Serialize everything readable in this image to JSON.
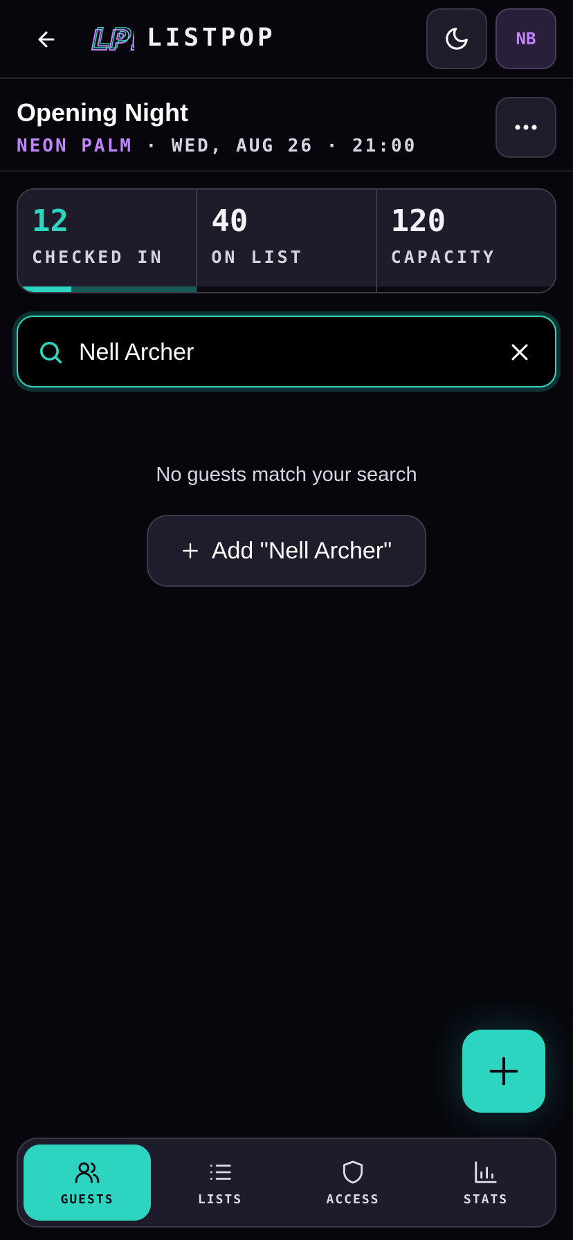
{
  "app": {
    "brand": "LISTPOP",
    "logo_text": "LP!",
    "user_initials": "NB"
  },
  "event": {
    "title": "Opening Night",
    "venue": "NEON PALM",
    "details": "· WED, AUG 26 · 21:00"
  },
  "stats": [
    {
      "value": "12",
      "label": "CHECKED IN",
      "progress": 0.3
    },
    {
      "value": "40",
      "label": "ON LIST"
    },
    {
      "value": "120",
      "label": "CAPACITY"
    }
  ],
  "search": {
    "value": "Nell Archer"
  },
  "empty_state": {
    "message": "No guests match your search",
    "add_label": "Add \"Nell Archer\""
  },
  "nav": [
    {
      "label": "GUESTS",
      "icon": "users-icon",
      "active": true
    },
    {
      "label": "LISTS",
      "icon": "list-icon",
      "active": false
    },
    {
      "label": "ACCESS",
      "icon": "shield-icon",
      "active": false
    },
    {
      "label": "STATS",
      "icon": "bar-chart-icon",
      "active": false
    }
  ],
  "colors": {
    "accent": "#2dd4bf",
    "purple": "#c084fc",
    "background": "#07060c",
    "surface": "#1e1b2b"
  }
}
